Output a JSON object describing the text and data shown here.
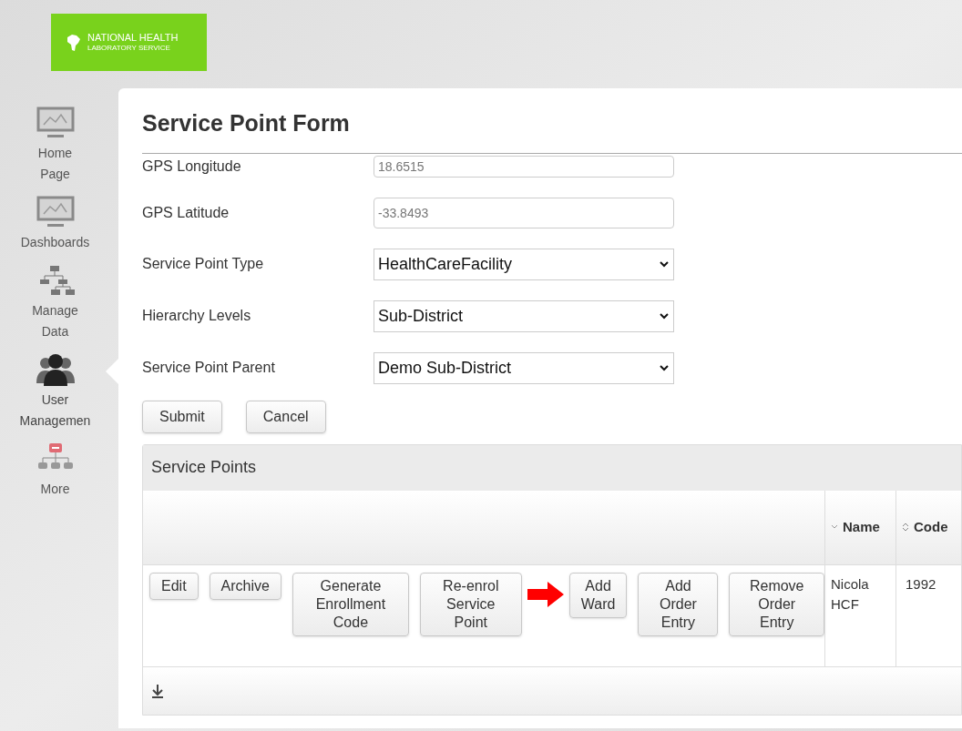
{
  "logo": {
    "line_1": "NATIONAL HEALTH",
    "line_2": "LABORATORY SERVICE"
  },
  "sidebar": {
    "items": [
      {
        "label": "Home Page",
        "kind": "monitor",
        "selected": false
      },
      {
        "label": "Dashboards",
        "kind": "monitor",
        "selected": false
      },
      {
        "label": "Manage Data",
        "kind": "hierarchy",
        "selected": false
      },
      {
        "label": "User Managemen",
        "kind": "users",
        "selected": true
      },
      {
        "label": "More",
        "kind": "more",
        "selected": false
      }
    ]
  },
  "form": {
    "title": "Service Point Form",
    "fields": [
      {
        "label": "GPS Longitude",
        "kind": "text",
        "value": "18.6515"
      },
      {
        "label": "GPS Latitude",
        "kind": "text",
        "value": "-33.8493"
      },
      {
        "label": "Service Point Type",
        "kind": "select",
        "value": "HealthCareFacility"
      },
      {
        "label": "Hierarchy Levels",
        "kind": "select",
        "value": "Sub-District"
      },
      {
        "label": "Service Point Parent",
        "kind": "select",
        "value": "Demo Sub-District"
      }
    ],
    "buttons": [
      "Submit",
      "Cancel"
    ]
  },
  "service_points": {
    "title": "Service Points",
    "columns": [
      {
        "label": "Name",
        "kind": "sorted"
      },
      {
        "label": "Code",
        "kind": "sortable"
      }
    ],
    "rows": [
      {
        "actions": [
          "Edit",
          "Archive",
          "Generate Enrollment Code",
          "Re-enrol Service Point",
          "Add Ward",
          "Add Order Entry",
          "Remove Order Entry"
        ],
        "name": "Nicola HCF",
        "code": "1992"
      }
    ]
  }
}
